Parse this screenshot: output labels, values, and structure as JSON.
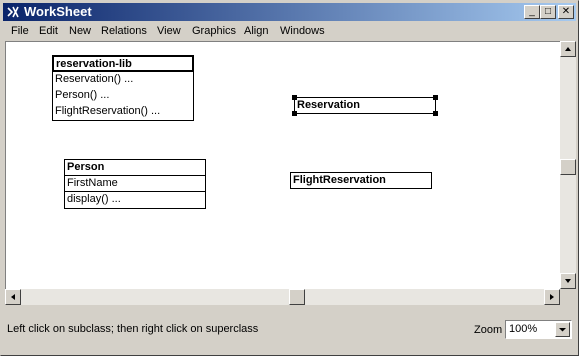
{
  "window": {
    "title": "WorkSheet"
  },
  "titlebar_buttons": {
    "minimize": "_",
    "maximize": "□",
    "close": "✕"
  },
  "menu": [
    "File",
    "Edit",
    "New",
    "Relations",
    "View",
    "Graphics",
    "Align",
    "Windows"
  ],
  "classes": {
    "reservation_lib": {
      "name": "reservation-lib",
      "rows": [
        "Reservation()  ...",
        "Person()  ...",
        "FlightReservation()  ..."
      ]
    },
    "person": {
      "name": "Person",
      "attributes": [
        "FirstName"
      ],
      "methods": [
        "display()  ..."
      ]
    },
    "reservation": {
      "name": "Reservation"
    },
    "flight_reservation": {
      "name": "FlightReservation"
    }
  },
  "status": {
    "message": "Left click on subclass; then right click on superclass"
  },
  "zoom": {
    "label": "Zoom",
    "value": "100%"
  },
  "colors": {
    "title_start": "#0a246a",
    "title_end": "#a6caf0",
    "chrome": "#d4d0c8"
  }
}
